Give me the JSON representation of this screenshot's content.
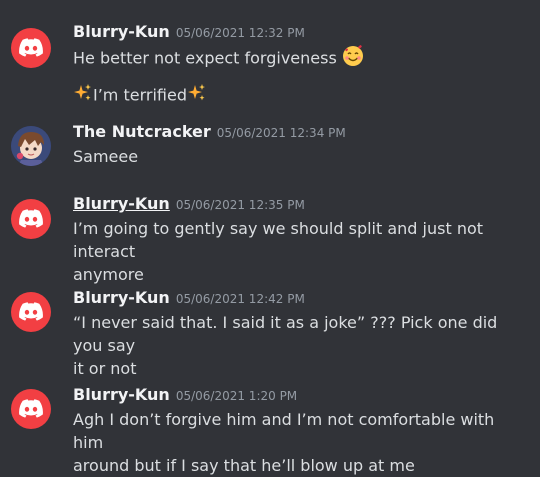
{
  "messages": [
    {
      "author": "Blurry-Kun",
      "timestamp": "05/06/2021 12:32 PM",
      "lines": [
        "He better not expect forgiveness",
        "I’m terrified"
      ],
      "avatar_icon": "discord-logo-icon",
      "emojis": [
        "smiling-face-with-hearts-emoji",
        "sparkles-emoji"
      ]
    },
    {
      "author": "The Nutcracker",
      "timestamp": "05/06/2021 12:34 PM",
      "lines": [
        "Sameee"
      ],
      "avatar_icon": "anime-avatar"
    },
    {
      "author": "Blurry-Kun",
      "timestamp": "05/06/2021 12:35 PM",
      "lines": [
        "I’m going to gently say we should split and just not interact",
        "anymore"
      ],
      "avatar_icon": "discord-logo-icon"
    },
    {
      "author": "Blurry-Kun",
      "timestamp": "05/06/2021 12:42 PM",
      "lines": [
        "“I never said that. I said it as a joke” ??? Pick one did you say",
        "it or not"
      ],
      "avatar_icon": "discord-logo-icon"
    },
    {
      "author": "Blurry-Kun",
      "timestamp": "05/06/2021 1:20 PM",
      "lines": [
        "Agh I don’t forgive him and I’m not comfortable with him",
        "around but if I say that he’ll blow up at me"
      ],
      "avatar_icon": "discord-logo-icon"
    }
  ],
  "colors": {
    "background": "#313338",
    "avatar_red": "#f23f43",
    "author": "#f2f3f5",
    "timestamp": "#949ba4",
    "text": "#dbdee1"
  }
}
